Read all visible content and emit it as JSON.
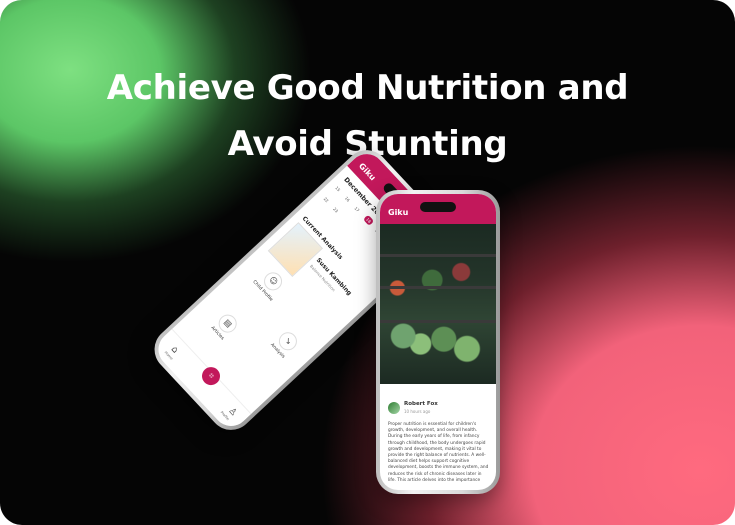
{
  "headline": {
    "line1": "Achieve Good Nutrition and",
    "line2": "Avoid Stunting"
  },
  "colors": {
    "brand": "#c2185b",
    "green_glow": "#7ee081",
    "pink_glow": "#f2627a"
  },
  "left_phone": {
    "brand": "Giku",
    "calendar_title": "December 2024",
    "calendar_days": [
      "15",
      "16",
      "17",
      "18",
      "19",
      "20",
      "21",
      "22",
      "23"
    ],
    "selected_day": "18",
    "section_title": "Current Analysis",
    "product_name": "Susu Kambing",
    "product_sub": "Balance Nutrition",
    "menu": [
      {
        "label": "Child Profile",
        "icon": "child-profile-icon"
      },
      {
        "label": "Analysis",
        "icon": "analysis-icon"
      },
      {
        "label": "Articles",
        "icon": "articles-icon"
      }
    ],
    "nav": [
      {
        "label": "Home",
        "icon": "home-icon"
      },
      {
        "label": "Scan",
        "icon": "scan-icon"
      },
      {
        "label": "Profile",
        "icon": "profile-icon"
      }
    ]
  },
  "right_phone": {
    "brand": "Giku",
    "author_name": "Robert Fox",
    "author_date": "10 hours ago",
    "article_body": "Proper nutrition is essential for children's growth, development, and overall health. During the early years of life, from infancy through childhood, the body undergoes rapid growth and development, making it vital to provide the right balance of nutrients. A well-balanced diet helps support cognitive development, boosts the immune system, and reduces the risk of chronic diseases later in life. This article delves into the importance"
  }
}
